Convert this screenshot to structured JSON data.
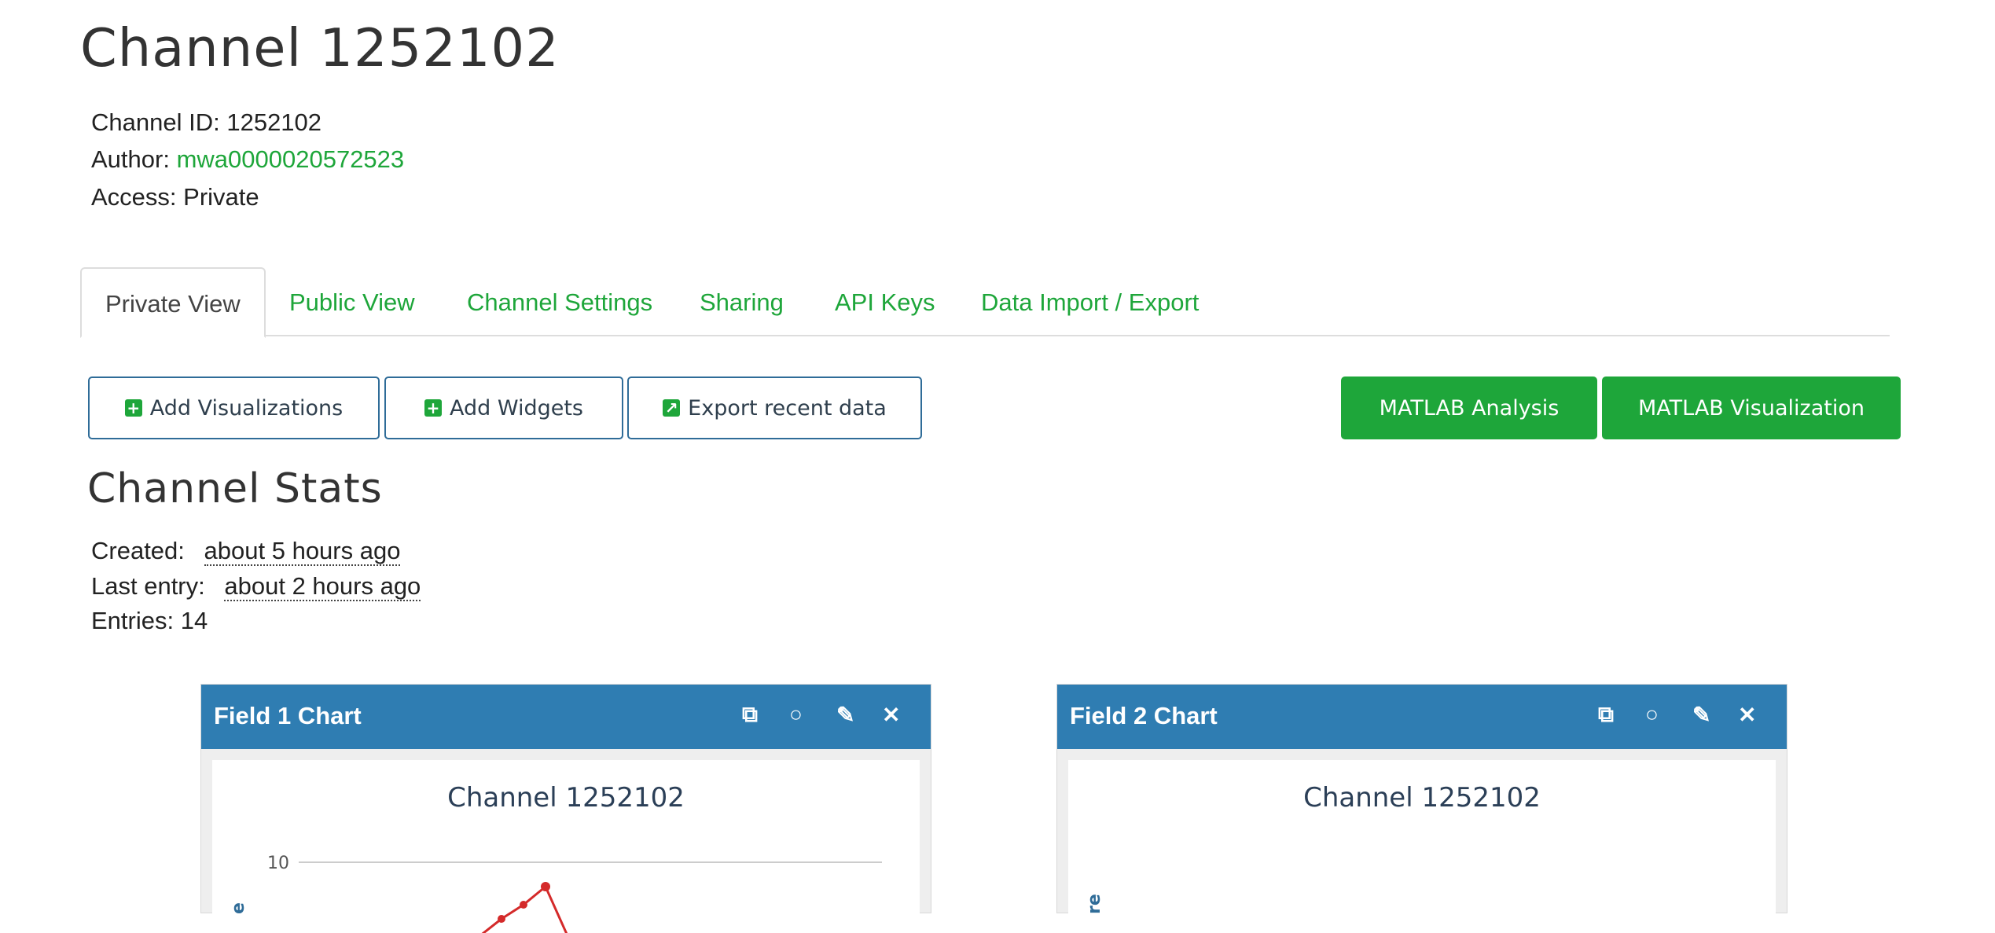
{
  "header": {
    "title": "Channel 1252102",
    "channel_id_label": "Channel ID:",
    "channel_id": "1252102",
    "author_label": "Author:",
    "author": "mwa0000020572523",
    "access_label": "Access:",
    "access": "Private"
  },
  "tabs": [
    {
      "label": "Private View",
      "active": true
    },
    {
      "label": "Public View"
    },
    {
      "label": "Channel Settings"
    },
    {
      "label": "Sharing"
    },
    {
      "label": "API Keys"
    },
    {
      "label": "Data Import / Export"
    }
  ],
  "toolbar": {
    "add_visualizations": "Add Visualizations",
    "add_widgets": "Add Widgets",
    "export_recent": "Export recent data",
    "matlab_analysis": "MATLAB Analysis",
    "matlab_visualization": "MATLAB Visualization"
  },
  "stats": {
    "heading": "Channel Stats",
    "created_label": "Created:",
    "created": "about 5 hours ago",
    "last_entry_label": "Last entry:",
    "last_entry": "about 2 hours ago",
    "entries_label": "Entries:",
    "entries": "14"
  },
  "charts": [
    {
      "panel_title": "Field 1 Chart",
      "chart_title": "Channel 1252102",
      "y_tick": "10",
      "y_label_fragment": "e"
    },
    {
      "panel_title": "Field 2 Chart",
      "chart_title": "Channel 1252102",
      "y_label_fragment": "re"
    }
  ],
  "colors": {
    "accent_green": "#1ea63a",
    "panel_header": "#2f7db2",
    "series_line": "#d42a2a"
  },
  "icons": [
    "plus-square-icon",
    "external-link-icon",
    "comment-icon",
    "pencil-icon",
    "close-icon"
  ]
}
